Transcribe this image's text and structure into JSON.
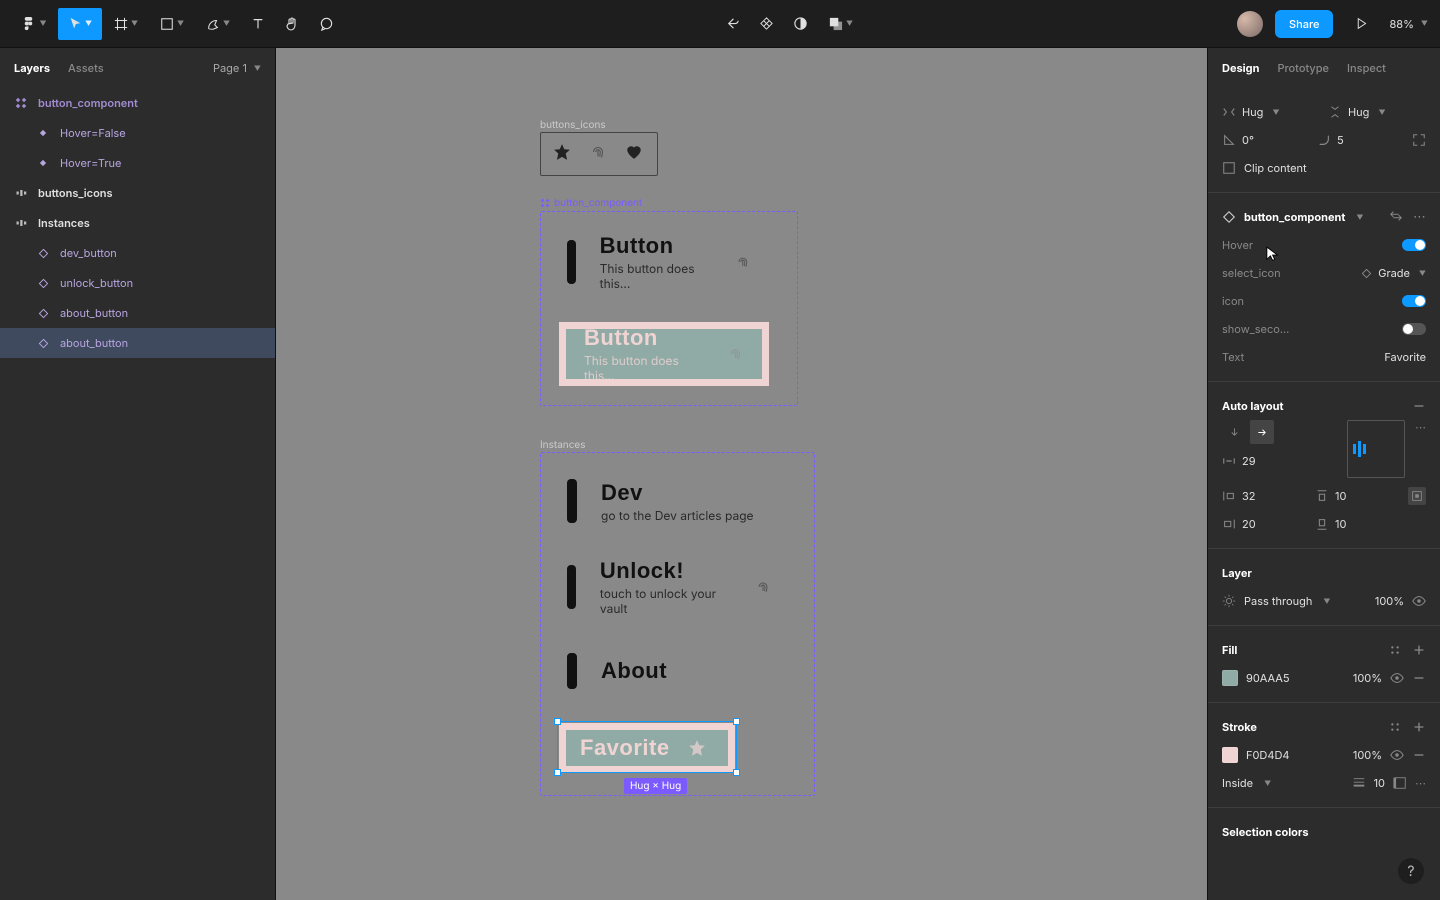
{
  "toolbar": {
    "share": "Share",
    "zoom": "88%"
  },
  "left": {
    "tab_layers": "Layers",
    "tab_assets": "Assets",
    "page": "Page 1",
    "layers": {
      "button_component": "button_component",
      "hover_false": "Hover=False",
      "hover_true": "Hover=True",
      "buttons_icons": "buttons_icons",
      "instances": "Instances",
      "dev_button": "dev_button",
      "unlock_button": "unlock_button",
      "about_button_1": "about_button",
      "about_button_2": "about_button"
    }
  },
  "canvas": {
    "labels": {
      "buttons_icons": "buttons_icons",
      "button_component": "button_component",
      "instances": "Instances"
    },
    "comp": {
      "default_title": "Button",
      "default_sub": "This button does this...",
      "hover_title": "Button",
      "hover_sub": "This button does this..."
    },
    "instances": {
      "dev_title": "Dev",
      "dev_sub": "go to the Dev articles page",
      "unlock_title": "Unlock!",
      "unlock_sub": "touch to unlock your vault",
      "about_title": "About",
      "favorite_title": "Favorite"
    },
    "hug_badge": "Hug × Hug"
  },
  "right": {
    "tabs": {
      "design": "Design",
      "prototype": "Prototype",
      "inspect": "Inspect"
    },
    "constraints": {
      "horiz": "Hug",
      "vert": "Hug",
      "rotation": "0°",
      "radius": "5",
      "clip_content": "Clip content"
    },
    "component": {
      "name": "button_component",
      "hover_label": "Hover",
      "select_icon_label": "select_icon",
      "select_icon_value": "Grade",
      "icon_label": "icon",
      "show_seco_label": "show_seco...",
      "text_label": "Text",
      "text_value": "Favorite"
    },
    "auto_layout": {
      "title": "Auto layout",
      "gap": "29",
      "pad_left": "32",
      "pad_top": "10",
      "pad_right": "20",
      "pad_bottom": "10"
    },
    "layer": {
      "title": "Layer",
      "mode": "Pass through",
      "opacity": "100%"
    },
    "fill": {
      "title": "Fill",
      "color": "90AAA5",
      "opacity": "100%"
    },
    "stroke": {
      "title": "Stroke",
      "color": "F0D4D4",
      "opacity": "100%",
      "position": "Inside",
      "weight": "10"
    },
    "selection_colors": "Selection colors"
  }
}
